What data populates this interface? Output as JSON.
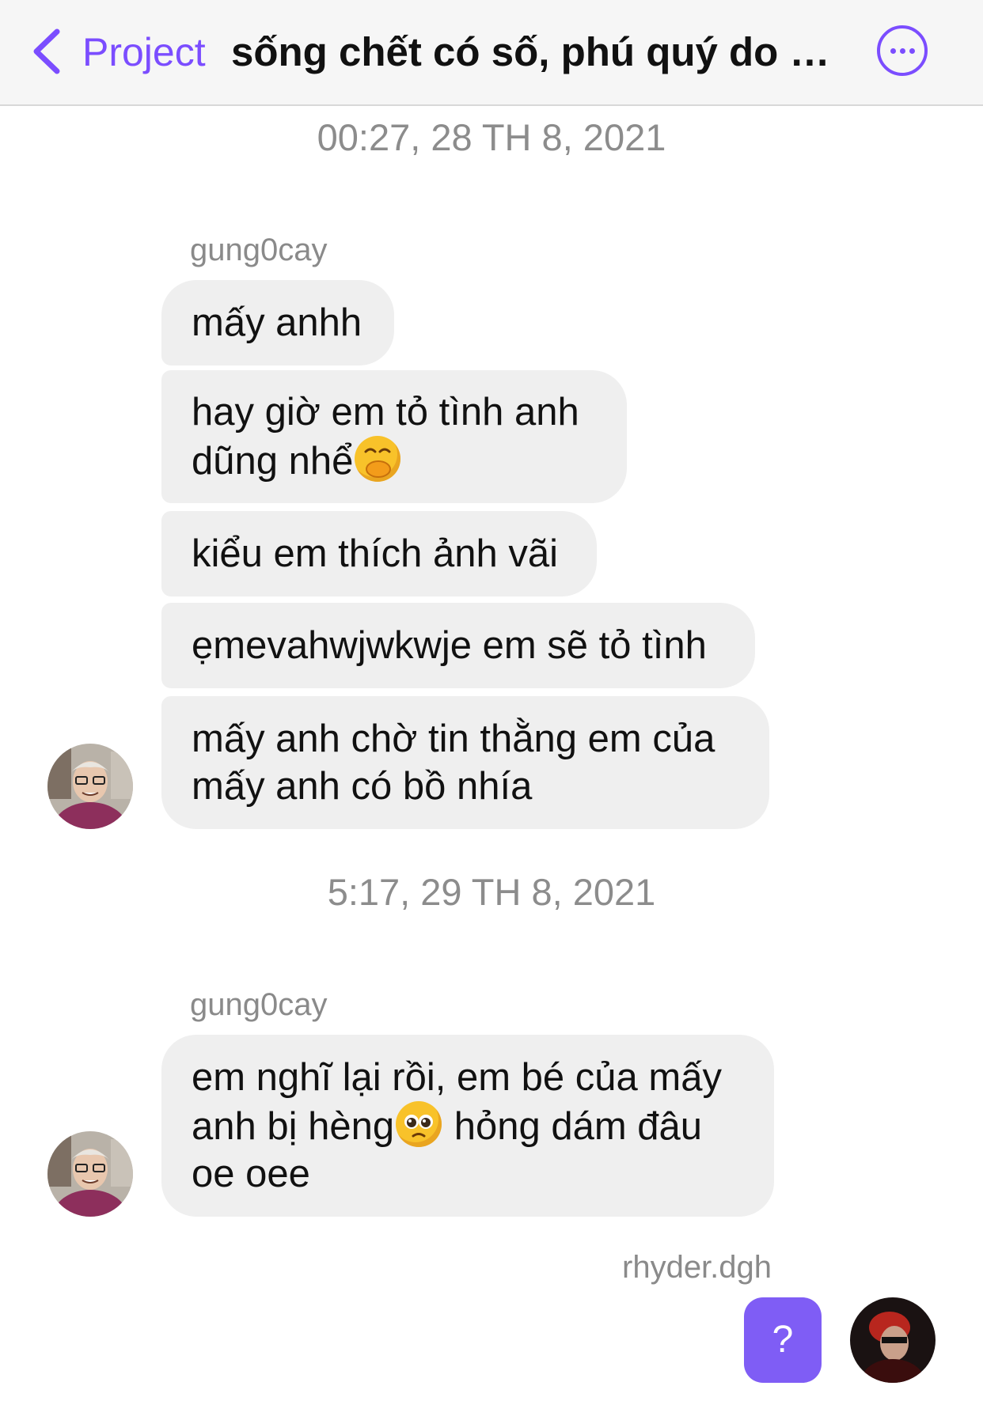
{
  "header": {
    "back_label": "Project",
    "title": "sống chết có số, phú quý do t...",
    "back_icon": "chevron-left-icon",
    "more_icon": "more-horizontal-icon"
  },
  "colors": {
    "accent": "#7b4dff",
    "bubble_incoming": "#efefef",
    "reply_button": "#7f5df5"
  },
  "groups": [
    {
      "timestamp": "00:27, 28 TH 8, 2021",
      "sender": "gung0cay",
      "messages": [
        {
          "text": "mấy anhh"
        },
        {
          "text": "hay giờ em tỏ tình anh dũng nhể",
          "emoji": "hand-over-mouth-emoji"
        },
        {
          "text": "kiểu em thích ảnh vãi"
        },
        {
          "text": "ẹmevahwjwkwje em sẽ tỏ tình"
        },
        {
          "text": "mấy anh chờ tin thằng em của mấy anh có bồ nhía"
        }
      ]
    },
    {
      "timestamp": "5:17, 29 TH 8, 2021",
      "sender": "gung0cay",
      "messages": [
        {
          "text_before": "em nghĩ lại rồi, em bé của mấy anh bị hèng",
          "emoji": "pleading-face-emoji",
          "text_after": " hỏng dám đâu oe oee"
        }
      ]
    }
  ],
  "outgoing": {
    "sender": "rhyder.dgh",
    "message": "?"
  }
}
